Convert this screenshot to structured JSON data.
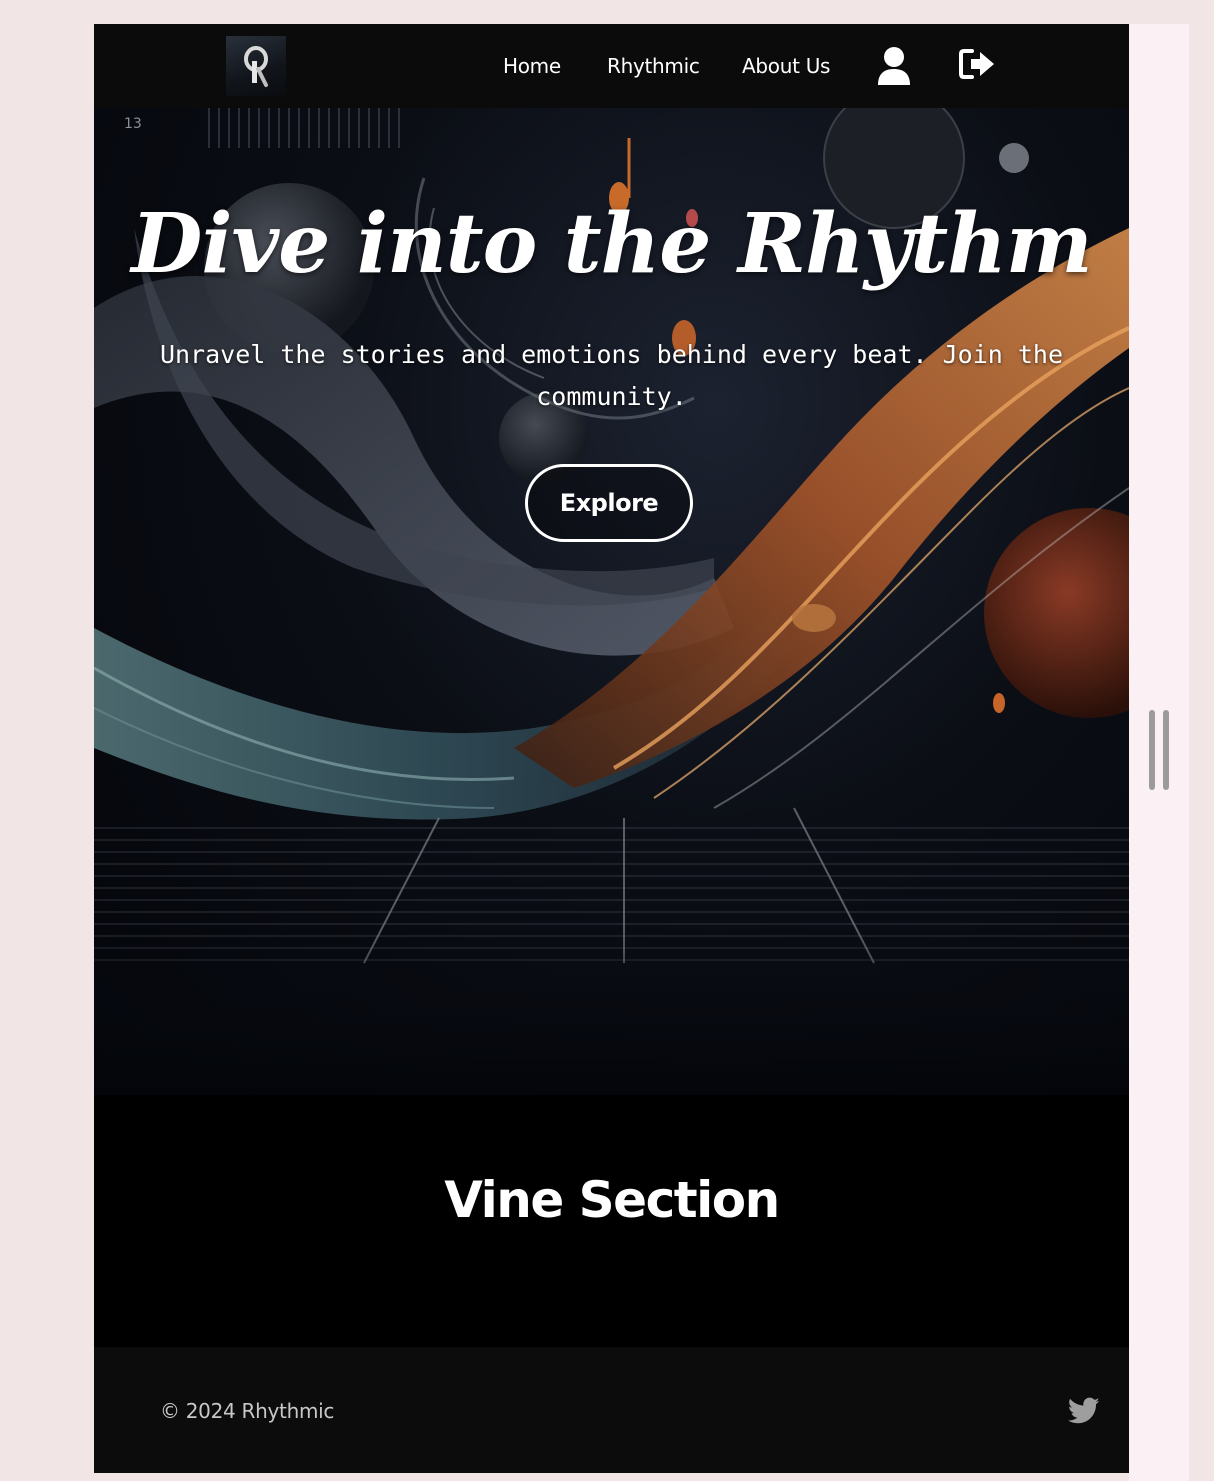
{
  "navbar": {
    "logo_icon": "rhythmic-logo-icon",
    "links": [
      {
        "label": "Home"
      },
      {
        "label": "Rhythmic"
      },
      {
        "label": "About Us"
      }
    ],
    "icons": [
      "user-icon",
      "sign-out-icon"
    ]
  },
  "hero": {
    "title": "Dive into the Rhythm",
    "subtitle": "Unravel the stories and emotions behind every beat. Join the community.",
    "button_label": "Explore",
    "background": "abstract-music-waves-image"
  },
  "vine_section": {
    "title": "Vine Section"
  },
  "footer": {
    "copyright": "© 2024 Rhythmic",
    "social_icon": "twitter-icon"
  },
  "colors": {
    "page_background": "#f1e5e5",
    "navbar": "#0b0b0b",
    "section_background": "#000000",
    "footer": "#0c0c0c",
    "text": "#ffffff",
    "footer_text": "#c8c8c8",
    "twitter_icon": "#9e9e9e"
  }
}
